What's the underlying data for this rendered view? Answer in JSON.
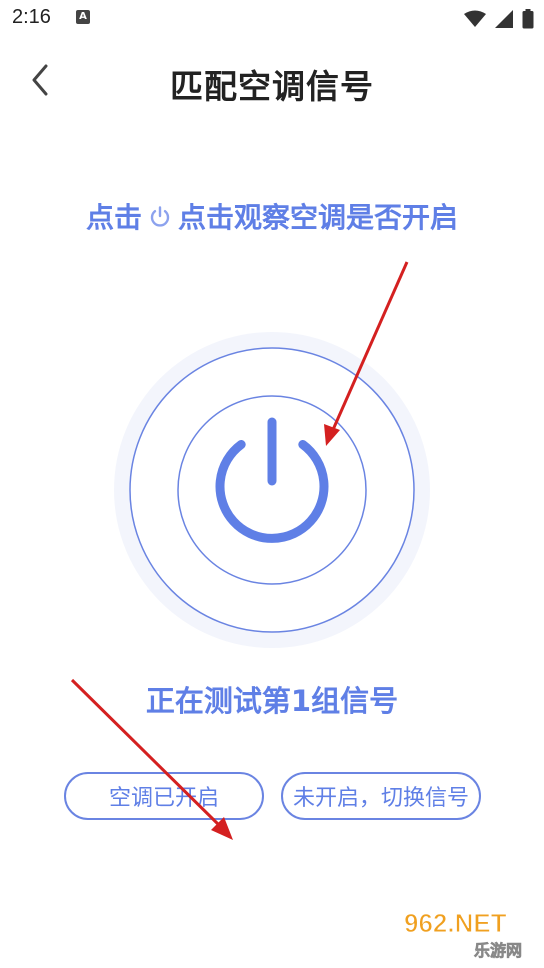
{
  "status_bar": {
    "time": "2:16",
    "notification_letter": "A"
  },
  "header": {
    "title": "匹配空调信号"
  },
  "instruction": {
    "prefix": "点击",
    "suffix": "点击观察空调是否开启"
  },
  "testing": {
    "label": "正在测试第1组信号"
  },
  "buttons": {
    "on_label": "空调已开启",
    "off_label": "未开启，切换信号"
  },
  "watermark": {
    "brand": "962.NET",
    "site": "乐游网"
  },
  "colors": {
    "accent": "#5f7fe6",
    "ring": "#6a84e2",
    "halo": "#f2f4fc",
    "annotation": "#d42020"
  }
}
